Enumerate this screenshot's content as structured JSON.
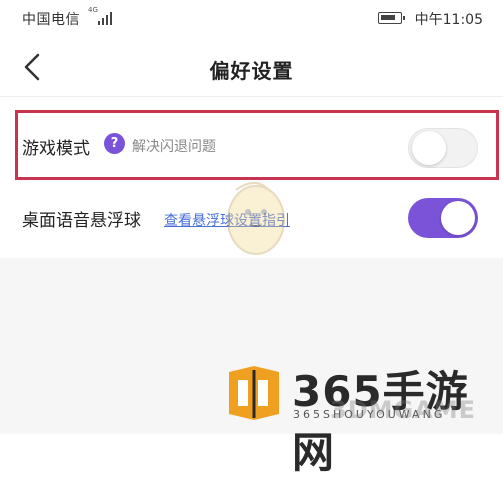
{
  "status_bar": {
    "carrier": "中国电信",
    "network": "4G",
    "time": "中午11:05"
  },
  "header": {
    "title": "偏好设置"
  },
  "settings": {
    "game_mode": {
      "label": "游戏模式",
      "help_symbol": "?",
      "hint": "解决闪退问题",
      "enabled": false
    },
    "floating_ball": {
      "label": "桌面语音悬浮球",
      "link": "查看悬浮球设置指引",
      "enabled": true
    }
  },
  "watermark": {
    "brand": "365手游网",
    "sub": "365SHOUYOUWANG",
    "secondary": "3DMGAME"
  },
  "colors": {
    "accent": "#7a53d9",
    "highlight_border": "#c8334f",
    "link": "#4a6fd8"
  }
}
